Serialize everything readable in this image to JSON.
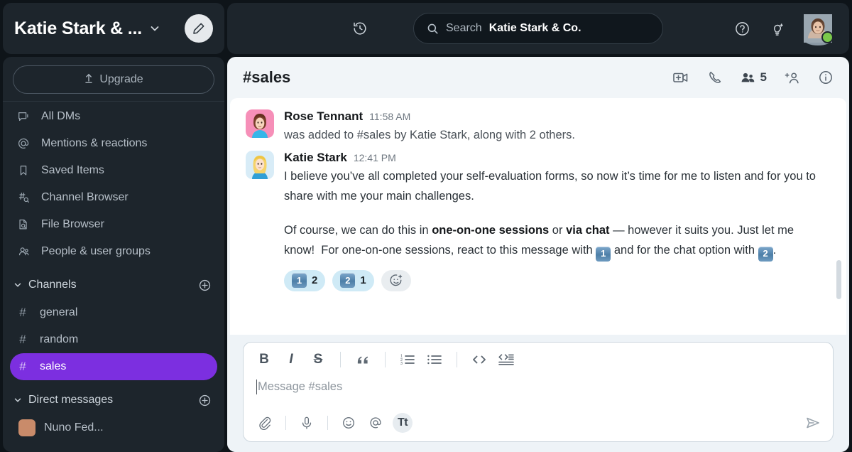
{
  "workspace": {
    "title": "Katie Stark & ...",
    "chevron_icon": "chevron-down-icon",
    "compose_icon": "pencil-icon",
    "upgrade_label": "Upgrade",
    "upgrade_icon": "upload-icon"
  },
  "sidebar": {
    "nav_items": [
      {
        "label": "All DMs",
        "icon": "all-dms-icon"
      },
      {
        "label": "Mentions & reactions",
        "icon": "at-sign-icon"
      },
      {
        "label": "Saved Items",
        "icon": "bookmark-icon"
      },
      {
        "label": "Channel Browser",
        "icon": "channel-search-icon"
      },
      {
        "label": "File Browser",
        "icon": "file-search-icon"
      },
      {
        "label": "People & user groups",
        "icon": "people-icon"
      }
    ],
    "channels_section": {
      "label": "Channels",
      "add_icon": "plus-circle-icon",
      "caret_icon": "chevron-down-icon"
    },
    "channels": [
      {
        "name": "general",
        "active": false
      },
      {
        "name": "random",
        "active": false
      },
      {
        "name": "sales",
        "active": true
      }
    ],
    "dms_section": {
      "label": "Direct messages",
      "add_icon": "plus-circle-icon",
      "caret_icon": "chevron-down-icon"
    },
    "dms": [
      {
        "name": "Nuno Fed..."
      }
    ]
  },
  "topbar": {
    "history_icon": "history-clock-icon",
    "search": {
      "placeholder": "Search",
      "value": "Katie Stark & Co.",
      "icon": "search-icon"
    },
    "help_icon": "help-circle-icon",
    "ideas_icon": "lightbulb-sparkle-icon",
    "avatar": {
      "name": "user-avatar",
      "presence": "online",
      "presence_color": "#7bc94b"
    }
  },
  "channel": {
    "name": "#sales",
    "actions": [
      {
        "name": "start-huddle-video",
        "icon": "video-plus-icon"
      },
      {
        "name": "call",
        "icon": "phone-icon"
      },
      {
        "name": "members",
        "icon": "people-icon",
        "count": "5"
      },
      {
        "name": "add-people",
        "icon": "person-plus-icon"
      },
      {
        "name": "channel-info",
        "icon": "info-circle-icon"
      }
    ]
  },
  "messages": [
    {
      "author": "Rose Tennant",
      "time": "11:58 AM",
      "avatar_color": "#f68fb8",
      "kind": "meta",
      "paragraphs": [
        {
          "runs": [
            {
              "t": "was added to #sales by Katie Stark, along with 2 others."
            }
          ]
        }
      ],
      "reactions": []
    },
    {
      "author": "Katie Stark",
      "time": "12:41 PM",
      "avatar_color": "#d8ecf7",
      "kind": "normal",
      "paragraphs": [
        {
          "runs": [
            {
              "t": "I believe you’ve all completed your self-evaluation forms, so now it’s time for me to listen and for you to share with me your main challenges."
            }
          ]
        },
        {
          "runs": [
            {
              "t": "Of course, we can do this in "
            },
            {
              "t": "one-on-one sessions",
              "b": true
            },
            {
              "t": " or "
            },
            {
              "t": "via chat",
              "b": true
            },
            {
              "t": " — however it suits you. Just let me know!  For one-on-one sessions, react to this message with "
            },
            {
              "t": "1",
              "keycap": true
            },
            {
              "t": " and for the chat option with "
            },
            {
              "t": "2",
              "keycap": true
            },
            {
              "t": "."
            }
          ]
        }
      ],
      "reactions": [
        {
          "emoji": "1",
          "count": "2"
        },
        {
          "emoji": "2",
          "count": "1"
        }
      ],
      "add_reaction_icon": "add-reaction-icon"
    }
  ],
  "composer": {
    "placeholder": "Message #sales",
    "format_buttons": [
      {
        "name": "bold-button",
        "label": "B",
        "icon": "bold-icon"
      },
      {
        "name": "italic-button",
        "label": "I",
        "icon": "italic-icon"
      },
      {
        "name": "strikethrough-button",
        "label": "S",
        "icon": "strikethrough-icon"
      },
      {
        "name": "blockquote-button",
        "icon": "quote-icon"
      },
      {
        "name": "ordered-list-button",
        "icon": "ordered-list-icon"
      },
      {
        "name": "bulleted-list-button",
        "icon": "bulleted-list-icon"
      },
      {
        "name": "inline-code-button",
        "icon": "code-icon"
      },
      {
        "name": "code-block-button",
        "icon": "code-block-icon"
      }
    ],
    "bottom_buttons": [
      {
        "name": "attach-file-button",
        "icon": "paperclip-icon"
      },
      {
        "name": "record-audio-button",
        "icon": "microphone-icon"
      },
      {
        "name": "emoji-button",
        "icon": "smiley-icon"
      },
      {
        "name": "mention-button",
        "icon": "at-sign-icon"
      },
      {
        "name": "formatting-button",
        "icon": "text-format-icon",
        "label": "Tt",
        "active": true
      }
    ],
    "send_icon": "send-plane-icon"
  },
  "colors": {
    "accent": "#7c2fe0",
    "sidebar_bg": "#1d252c",
    "app_bg": "#0e1419",
    "content_bg": "#f1f5f8",
    "reaction_bg": "#cfeaf6",
    "presence_green": "#7bc94b"
  }
}
